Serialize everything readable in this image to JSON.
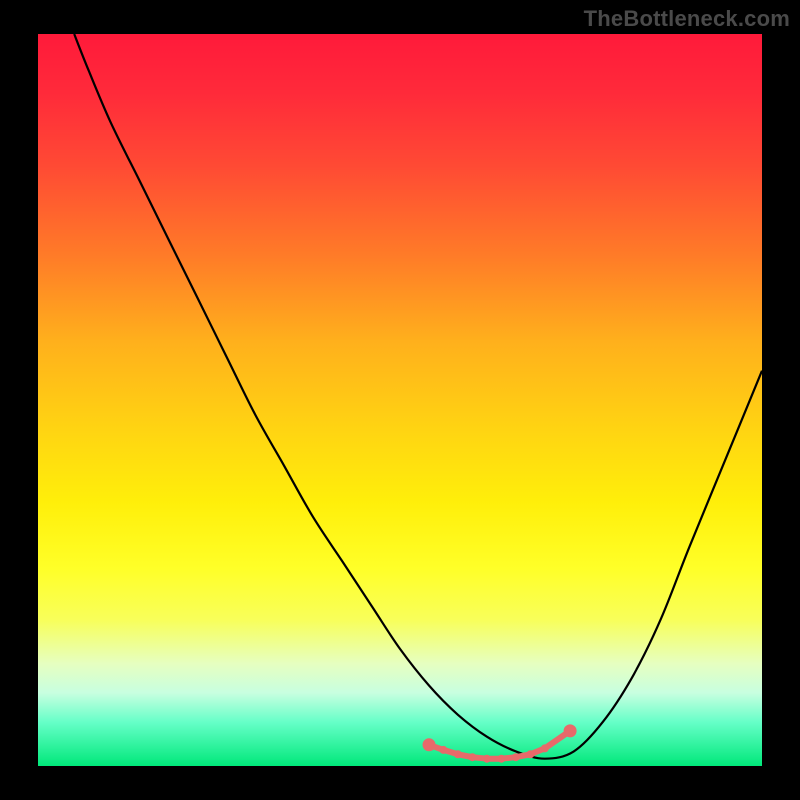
{
  "watermark": "TheBottleneck.com",
  "colors": {
    "gradient_top": "#ff1a3a",
    "gradient_bottom": "#00e87a",
    "curve_stroke": "#000000",
    "bottom_marker": "#e86a6a"
  },
  "chart_data": {
    "type": "line",
    "title": "",
    "xlabel": "",
    "ylabel": "",
    "xlim": [
      0,
      100
    ],
    "ylim": [
      0,
      100
    ],
    "series": [
      {
        "name": "curve",
        "x": [
          5,
          7,
          10,
          14,
          18,
          22,
          26,
          30,
          34,
          38,
          42,
          46,
          50,
          54,
          58,
          62,
          66,
          70,
          74,
          78,
          82,
          86,
          90,
          95,
          100
        ],
        "y": [
          100,
          95,
          88,
          80,
          72,
          64,
          56,
          48,
          41,
          34,
          28,
          22,
          16,
          11,
          7,
          4,
          2,
          1,
          2,
          6,
          12,
          20,
          30,
          42,
          54
        ]
      }
    ],
    "bottom_markers": {
      "x": [
        54,
        56,
        58,
        60,
        62,
        64,
        66,
        68,
        70,
        73.5
      ],
      "y": [
        2.9,
        2.2,
        1.6,
        1.2,
        1.0,
        1.0,
        1.2,
        1.6,
        2.4,
        4.8
      ]
    }
  }
}
